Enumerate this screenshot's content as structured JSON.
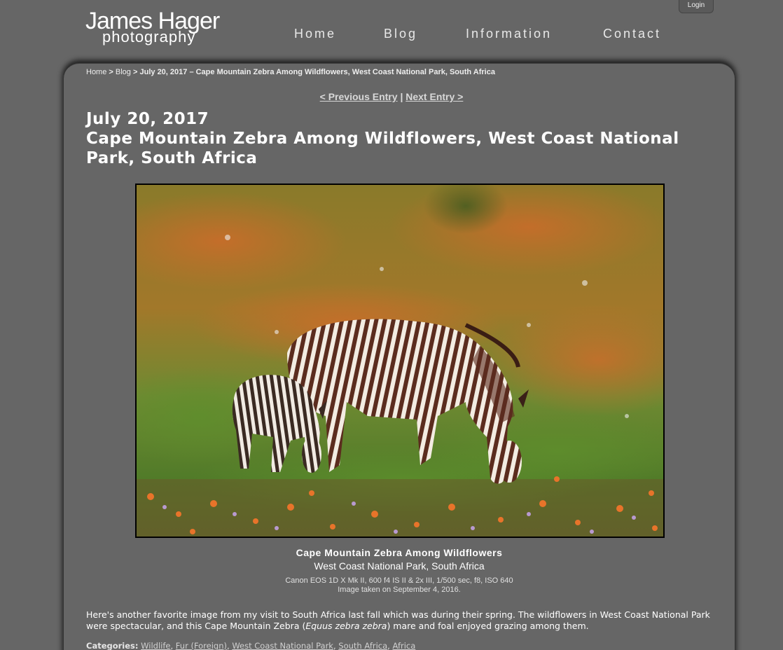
{
  "header": {
    "logo_line1": "James Hager",
    "logo_line2": "photography",
    "login": "Login",
    "nav": [
      "Home",
      "Blog",
      "Information",
      "Contact"
    ]
  },
  "breadcrumb": {
    "home": "Home",
    "blog": "Blog",
    "current": "July 20, 2017 – Cape Mountain Zebra Among Wildflowers, West Coast National Park, South Africa"
  },
  "entry_nav": {
    "previous": "< Previous Entry",
    "separator": "|",
    "next": "Next Entry >"
  },
  "post": {
    "date": "July 20, 2017",
    "title": "Cape Mountain Zebra Among Wildflowers, West Coast National Park, South Africa",
    "caption_title": "Cape Mountain Zebra Among Wildflowers",
    "caption_location": "West Coast National Park, South Africa",
    "camera_info": "Canon EOS 1D X Mk II, 600 f4 IS II & 2x III, 1/500 sec, f8, ISO 640",
    "date_taken": "Image taken on September 4, 2016.",
    "body_part1": "Here's another favorite image from my visit to South Africa last fall which was during their spring. The wildflowers in West Coast National Park were spectacular, and this Cape Mountain Zebra (",
    "body_italic": "Equus zebra zebra",
    "body_part2": ") mare and foal enjoyed grazing among them.",
    "categories_label": "Categories:",
    "categories": [
      "Wildlife",
      "Fur (Foreign)",
      "West Coast National Park",
      "South Africa",
      "Africa"
    ]
  }
}
